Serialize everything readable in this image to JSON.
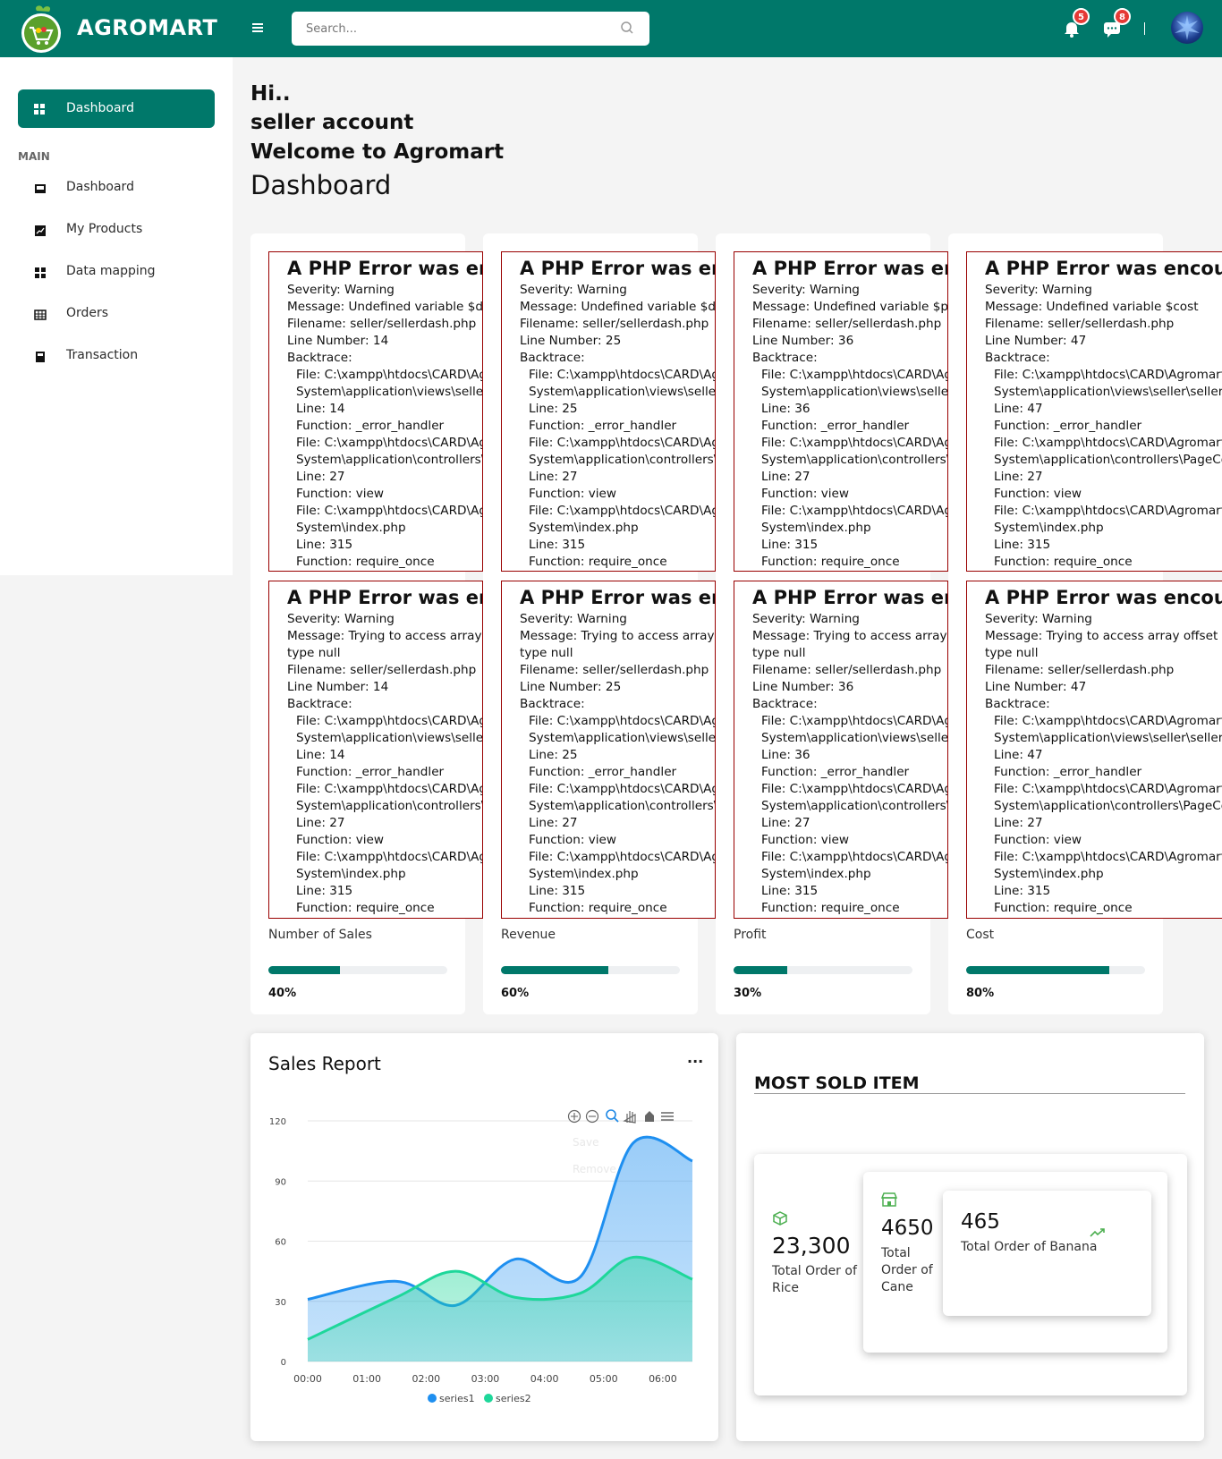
{
  "header": {
    "brand": "AGROMART",
    "search_placeholder": "Search...",
    "notifications_count": "5",
    "messages_count": "8"
  },
  "sidebar": {
    "active_label": "Dashboard",
    "section": "MAIN",
    "items": [
      {
        "label": "Dashboard",
        "icon": "inbox-icon"
      },
      {
        "label": "My Products",
        "icon": "chart-icon"
      },
      {
        "label": "Data mapping",
        "icon": "grid-icon"
      },
      {
        "label": "Orders",
        "icon": "table-icon"
      },
      {
        "label": "Transaction",
        "icon": "calculator-icon"
      }
    ]
  },
  "greeting": {
    "line1": "Hi..",
    "line2": "seller account",
    "line3": "Welcome to Agromart",
    "title": "Dashboard"
  },
  "stats": [
    {
      "label": "Number of Sales",
      "percent_text": "40%",
      "progress": 40,
      "errors": [
        {
          "heading": "A PHP Error was encountered",
          "severity": "Severity: Warning",
          "message": "Message: Undefined variable $data",
          "message2": "",
          "filename": "Filename: seller/sellerdash.php",
          "line_number": "Line Number: 14",
          "backtrace": "Backtrace:",
          "file1": "File: C:\\xampp\\htdocs\\CARD\\Agromart",
          "path1": "System\\application\\views\\seller\\sellerdash.php",
          "line1": "Line: 14",
          "func1": "Function: _error_handler",
          "file2": "File: C:\\xampp\\htdocs\\CARD\\Agromart",
          "path2": "System\\application\\controllers\\PageController.php",
          "line2": "Line: 27",
          "func2": "Function: view",
          "file3": "File: C:\\xampp\\htdocs\\CARD\\Agromart",
          "path3": "System\\index.php",
          "line3": "Line: 315",
          "func3": "Function: require_once"
        },
        {
          "heading": "A PHP Error was encountered",
          "severity": "Severity: Warning",
          "message": "Message: Trying to access array offset on value of",
          "message2": "type null",
          "filename": "Filename: seller/sellerdash.php",
          "line_number": "Line Number: 14",
          "backtrace": "Backtrace:",
          "file1": "File: C:\\xampp\\htdocs\\CARD\\Agromart",
          "path1": "System\\application\\views\\seller\\sellerdash.php",
          "line1": "Line: 14",
          "func1": "Function: _error_handler",
          "file2": "File: C:\\xampp\\htdocs\\CARD\\Agromart",
          "path2": "System\\application\\controllers\\PageController.php",
          "line2": "Line: 27",
          "func2": "Function: view",
          "file3": "File: C:\\xampp\\htdocs\\CARD\\Agromart",
          "path3": "System\\index.php",
          "line3": "Line: 315",
          "func3": "Function: require_once"
        }
      ]
    },
    {
      "label": "Revenue",
      "percent_text": "60%",
      "progress": 60,
      "errors": [
        {
          "heading": "A PHP Error was encountered",
          "severity": "Severity: Warning",
          "message": "Message: Undefined variable $data",
          "message2": "",
          "filename": "Filename: seller/sellerdash.php",
          "line_number": "Line Number: 25",
          "backtrace": "Backtrace:",
          "file1": "File: C:\\xampp\\htdocs\\CARD\\Agromart",
          "path1": "System\\application\\views\\seller\\sellerdash.php",
          "line1": "Line: 25",
          "func1": "Function: _error_handler",
          "file2": "File: C:\\xampp\\htdocs\\CARD\\Agromart",
          "path2": "System\\application\\controllers\\PageController.php",
          "line2": "Line: 27",
          "func2": "Function: view",
          "file3": "File: C:\\xampp\\htdocs\\CARD\\Agromart",
          "path3": "System\\index.php",
          "line3": "Line: 315",
          "func3": "Function: require_once"
        },
        {
          "heading": "A PHP Error was encountered",
          "severity": "Severity: Warning",
          "message": "Message: Trying to access array offset on value of",
          "message2": "type null",
          "filename": "Filename: seller/sellerdash.php",
          "line_number": "Line Number: 25",
          "backtrace": "Backtrace:",
          "file1": "File: C:\\xampp\\htdocs\\CARD\\Agromart",
          "path1": "System\\application\\views\\seller\\sellerdash.php",
          "line1": "Line: 25",
          "func1": "Function: _error_handler",
          "file2": "File: C:\\xampp\\htdocs\\CARD\\Agromart",
          "path2": "System\\application\\controllers\\PageController.php",
          "line2": "Line: 27",
          "func2": "Function: view",
          "file3": "File: C:\\xampp\\htdocs\\CARD\\Agromart",
          "path3": "System\\index.php",
          "line3": "Line: 315",
          "func3": "Function: require_once"
        }
      ]
    },
    {
      "label": "Profit",
      "percent_text": "30%",
      "progress": 30,
      "errors": [
        {
          "heading": "A PHP Error was encountered",
          "severity": "Severity: Warning",
          "message": "Message: Undefined variable $profit",
          "message2": "",
          "filename": "Filename: seller/sellerdash.php",
          "line_number": "Line Number: 36",
          "backtrace": "Backtrace:",
          "file1": "File: C:\\xampp\\htdocs\\CARD\\Agromart",
          "path1": "System\\application\\views\\seller\\sellerdash.php",
          "line1": "Line: 36",
          "func1": "Function: _error_handler",
          "file2": "File: C:\\xampp\\htdocs\\CARD\\Agromart",
          "path2": "System\\application\\controllers\\PageController.php",
          "line2": "Line: 27",
          "func2": "Function: view",
          "file3": "File: C:\\xampp\\htdocs\\CARD\\Agromart",
          "path3": "System\\index.php",
          "line3": "Line: 315",
          "func3": "Function: require_once"
        },
        {
          "heading": "A PHP Error was encountered",
          "severity": "Severity: Warning",
          "message": "Message: Trying to access array offset on value of",
          "message2": "type null",
          "filename": "Filename: seller/sellerdash.php",
          "line_number": "Line Number: 36",
          "backtrace": "Backtrace:",
          "file1": "File: C:\\xampp\\htdocs\\CARD\\Agromart",
          "path1": "System\\application\\views\\seller\\sellerdash.php",
          "line1": "Line: 36",
          "func1": "Function: _error_handler",
          "file2": "File: C:\\xampp\\htdocs\\CARD\\Agromart",
          "path2": "System\\application\\controllers\\PageController.php",
          "line2": "Line: 27",
          "func2": "Function: view",
          "file3": "File: C:\\xampp\\htdocs\\CARD\\Agromart",
          "path3": "System\\index.php",
          "line3": "Line: 315",
          "func3": "Function: require_once"
        }
      ]
    },
    {
      "label": "Cost",
      "percent_text": "80%",
      "progress": 80,
      "errors": [
        {
          "heading": "A PHP Error was encountered",
          "severity": "Severity: Warning",
          "message": "Message: Undefined variable $cost",
          "message2": "",
          "filename": "Filename: seller/sellerdash.php",
          "line_number": "Line Number: 47",
          "backtrace": "Backtrace:",
          "file1": "File: C:\\xampp\\htdocs\\CARD\\Agromart",
          "path1": "System\\application\\views\\seller\\sellerdash.php",
          "line1": "Line: 47",
          "func1": "Function: _error_handler",
          "file2": "File: C:\\xampp\\htdocs\\CARD\\Agromart",
          "path2": "System\\application\\controllers\\PageController.php",
          "line2": "Line: 27",
          "func2": "Function: view",
          "file3": "File: C:\\xampp\\htdocs\\CARD\\Agromart",
          "path3": "System\\index.php",
          "line3": "Line: 315",
          "func3": "Function: require_once"
        },
        {
          "heading": "A PHP Error was encountered",
          "severity": "Severity: Warning",
          "message": "Message: Trying to access array offset on value of",
          "message2": "type null",
          "filename": "Filename: seller/sellerdash.php",
          "line_number": "Line Number: 47",
          "backtrace": "Backtrace:",
          "file1": "File: C:\\xampp\\htdocs\\CARD\\Agromart",
          "path1": "System\\application\\views\\seller\\sellerdash.php",
          "line1": "Line: 47",
          "func1": "Function: _error_handler",
          "file2": "File: C:\\xampp\\htdocs\\CARD\\Agromart",
          "path2": "System\\application\\controllers\\PageController.php",
          "line2": "Line: 27",
          "func2": "Function: view",
          "file3": "File: C:\\xampp\\htdocs\\CARD\\Agromart",
          "path3": "System\\index.php",
          "line3": "Line: 315",
          "func3": "Function: require_once"
        }
      ]
    }
  ],
  "sales_report": {
    "title": "Sales Report",
    "more_label": "...",
    "menu_items": [
      "Save",
      "Remove"
    ]
  },
  "chart_data": {
    "type": "area",
    "x": [
      "00:00",
      "01:00",
      "02:00",
      "03:00",
      "04:00",
      "05:00",
      "06:00"
    ],
    "ylim": [
      0,
      120
    ],
    "yticks": [
      0,
      30,
      60,
      90,
      120
    ],
    "grid": true,
    "legend_placement": "bottom",
    "series": [
      {
        "name": "series1",
        "color": "#1e8ff0",
        "points": [
          [
            0,
            31
          ],
          [
            1.5,
            40
          ],
          [
            2.5,
            28
          ],
          [
            3.5,
            51
          ],
          [
            4.6,
            42
          ],
          [
            5.5,
            109
          ],
          [
            6.5,
            100
          ]
        ]
      },
      {
        "name": "series2",
        "color": "#1ed79a",
        "points": [
          [
            0,
            11
          ],
          [
            1.5,
            32
          ],
          [
            2.5,
            45
          ],
          [
            3.5,
            32
          ],
          [
            4.6,
            34
          ],
          [
            5.5,
            52
          ],
          [
            6.5,
            41
          ]
        ]
      }
    ]
  },
  "most_sold": {
    "title": "MOST SOLD ITEM",
    "items": [
      {
        "value": "23,300",
        "label": "Total Order of Rice",
        "icon": "box-icon"
      },
      {
        "value": "4650",
        "label": "Total Order of Cane",
        "icon": "store-icon"
      },
      {
        "value": "465",
        "label": "Total Order of Banana",
        "icon": "trend-up-icon"
      }
    ]
  },
  "colors": {
    "primary": "#00786a",
    "error_border": "#990000",
    "badge": "#e53935"
  }
}
